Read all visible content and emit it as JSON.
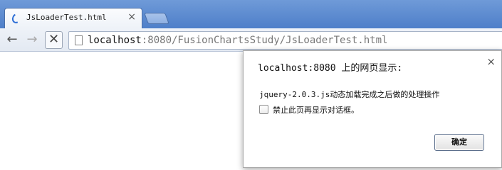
{
  "browser": {
    "tab": {
      "title": "JsLoaderTest.html",
      "close_glyph": "×",
      "loading_icon": "spinner-icon"
    },
    "new_tab_icon": "new-tab-icon",
    "toolbar": {
      "back_glyph": "←",
      "forward_glyph": "→",
      "stop_glyph": "✕",
      "url_host": "localhost",
      "url_rest": ":8080/FusionChartsStudy/JsLoaderTest.html",
      "page_icon": "page-icon"
    },
    "colors": {
      "tabstrip": "#5b8ad0",
      "toolbar": "#e8edf5"
    }
  },
  "dialog": {
    "title": "localhost:8080 上的网页显示:",
    "close_glyph": "×",
    "message": "jquery-2.0.3.js动态加载完成之后做的处理操作",
    "checkbox_label": "禁止此页再显示对话框。",
    "checkbox_checked": false,
    "ok_label": "确定"
  }
}
